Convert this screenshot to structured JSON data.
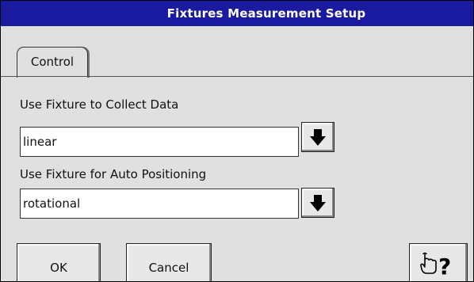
{
  "window": {
    "title": "Fixtures Measurement Setup"
  },
  "tabs": [
    {
      "label": "Control",
      "active": true
    }
  ],
  "collect": {
    "label": "Use Fixture to Collect Data",
    "value": "linear",
    "dropdown_icon": "arrow-down-icon"
  },
  "positioning": {
    "label": "Use Fixture for Auto Positioning",
    "value": "rotational",
    "dropdown_icon": "arrow-down-icon"
  },
  "buttons": {
    "ok": "OK",
    "cancel": "Cancel",
    "help_icon": "pointing-hand-question-icon"
  },
  "colors": {
    "titlebar": "#1a1aa0",
    "background": "#e0e0e0"
  }
}
